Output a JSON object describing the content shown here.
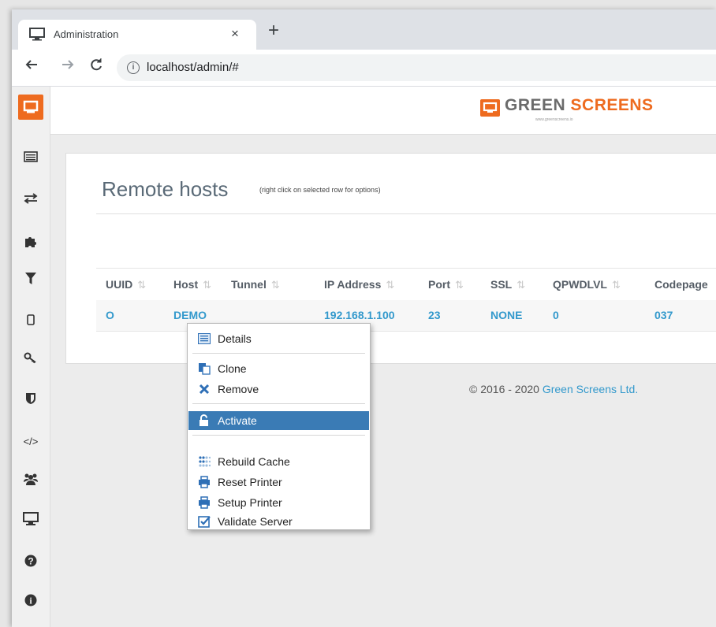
{
  "browser": {
    "tab_title": "Administration",
    "tab_close": "×",
    "new_tab": "+",
    "url": "localhost/admin/#",
    "back_icon": "arrow-left-icon",
    "forward_icon": "arrow-right-icon",
    "reload_icon": "reload-icon",
    "info_icon": "info-icon"
  },
  "sidebar": {
    "items": [
      {
        "name": "monitor-icon",
        "glyph": "▭"
      },
      {
        "name": "transfer-icon",
        "glyph": "⇄"
      },
      {
        "name": "puzzle-icon",
        "glyph": "✚"
      },
      {
        "name": "filter-icon",
        "glyph": "▼"
      },
      {
        "name": "mobile-icon",
        "glyph": "▯"
      },
      {
        "name": "key-icon",
        "glyph": "⚷"
      },
      {
        "name": "shield-icon",
        "glyph": "⛉"
      },
      {
        "name": "code-icon",
        "glyph": "</>"
      },
      {
        "name": "users-icon",
        "glyph": "👥"
      },
      {
        "name": "desktop-icon",
        "glyph": "▭"
      },
      {
        "name": "question-icon",
        "glyph": "?"
      },
      {
        "name": "info-circle-icon",
        "glyph": "i"
      }
    ]
  },
  "header": {
    "logo_part1": "GREEN",
    "logo_part2": "SCREENS",
    "logo_tagline": "www.greenscreens.io"
  },
  "main": {
    "title": "Remote hosts",
    "subtitle": "(right click on selected row for options)",
    "columns": [
      "UUID",
      "Host",
      "Tunnel",
      "IP Address",
      "Port",
      "SSL",
      "QPWDLVL",
      "Codepage"
    ],
    "sort_glyphs": [
      "⇅",
      "⇅",
      "⇅",
      "⇅",
      "⇅",
      "⇅",
      "⇅"
    ],
    "rows": [
      {
        "uuid": "O",
        "host": "DEMO",
        "tunnel": "",
        "ip": "192.168.1.100",
        "port": "23",
        "ssl": "NONE",
        "qpwdlvl": "0",
        "codepage": "037"
      }
    ]
  },
  "footer": {
    "copyright": "© 2016 - 2020 ",
    "company": "Green Screens Ltd."
  },
  "context_menu": {
    "items": [
      {
        "label": "Details",
        "icon": "list-icon"
      },
      {
        "label": "Clone",
        "icon": "clone-icon"
      },
      {
        "label": "Remove",
        "icon": "remove-icon"
      },
      {
        "label": "Activate",
        "icon": "unlock-icon",
        "active": true
      },
      {
        "label": "Rebuild Cache",
        "icon": "cache-icon"
      },
      {
        "label": "Reset Printer",
        "icon": "printer-icon"
      },
      {
        "label": "Setup Printer",
        "icon": "printer-icon"
      },
      {
        "label": "Validate Server",
        "icon": "checkbox-icon"
      }
    ]
  },
  "colors": {
    "brand_orange": "#ee6b1f",
    "link_blue": "#3399cc",
    "menu_highlight": "#3a7bb5"
  }
}
